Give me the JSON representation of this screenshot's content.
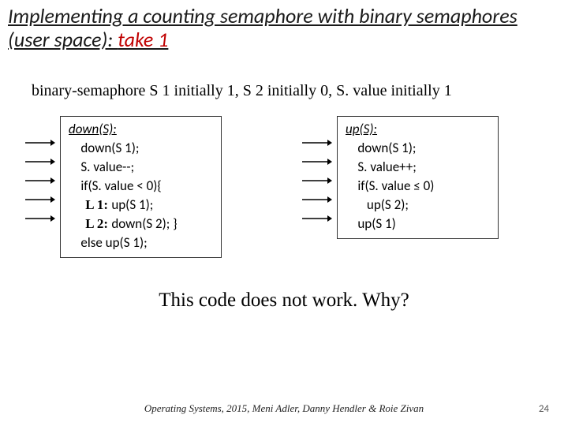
{
  "title_part1": "Implementing a counting semaphore with binary semaphores (user space): ",
  "title_part2": "take 1",
  "init_line": "binary-semaphore S 1 initially 1, S 2 initially 0,  S. value initially 1",
  "down": {
    "header": "down(S):",
    "lines": [
      "    down(S 1);",
      "    S. value--;",
      "    if(S. value < 0){",
      "L1_up",
      "L2_down",
      "    else up(S 1);"
    ],
    "l1_prefix": "     L 1: ",
    "l1_text": "up(S 1);",
    "l2_prefix": "     L 2: ",
    "l2_text": "down(S 2); }"
  },
  "up": {
    "header": "up(S):",
    "lines": [
      "    down(S 1);",
      "    S. value++;",
      "    if(S. value ≤ 0)",
      "       up(S 2);",
      "    up(S 1)"
    ]
  },
  "question": "This code does not work. Why?",
  "footer": "Operating Systems, 2015, Meni Adler, Danny Hendler & Roie Zivan",
  "page": "24"
}
